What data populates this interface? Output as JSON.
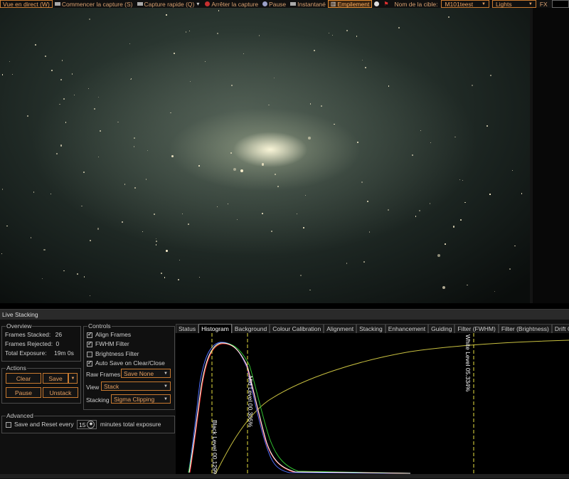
{
  "toolbar": {
    "live_view": "Vue en direct (W)",
    "start_capture": "Commencer la capture (S)",
    "quick_capture": "Capture rapide (Q)",
    "stop_capture": "Arrêter la capture",
    "pause": "Pause",
    "snapshot": "Instantané",
    "stacking": "Empilement",
    "target_label": "Nom de la cible:",
    "target_value": "M101teest",
    "frame_type": "Lights",
    "fx_label": "FX"
  },
  "panel": {
    "title": "Live Stacking",
    "overview": {
      "legend": "Overview",
      "frames_stacked_label": "Frames Stacked:",
      "frames_stacked": "26",
      "frames_rejected_label": "Frames Rejected:",
      "frames_rejected": "0",
      "total_exposure_label": "Total Exposure:",
      "total_exposure": "19m 0s"
    },
    "actions": {
      "legend": "Actions",
      "clear": "Clear",
      "save": "Save",
      "pause": "Pause",
      "unstack": "Unstack"
    },
    "controls": {
      "legend": "Controls",
      "align_frames": "Align Frames",
      "align_frames_checked": true,
      "fwhm_filter": "FWHM Filter",
      "fwhm_filter_checked": true,
      "brightness_filter": "Brightness Filter",
      "brightness_filter_checked": false,
      "auto_save": "Auto Save on Clear/Close",
      "auto_save_checked": true,
      "raw_frames_label": "Raw Frames",
      "raw_frames_value": "Save None",
      "view_label": "View",
      "view_value": "Stack",
      "stacking_label": "Stacking",
      "stacking_value": "Sigma Clipping"
    },
    "advanced": {
      "legend": "Advanced",
      "save_reset_label": "Save and Reset every",
      "save_reset_value": "15",
      "minutes_label": "minutes total exposure",
      "save_reset_checked": false
    }
  },
  "tabs": [
    "Status",
    "Histogram",
    "Background",
    "Colour Calibration",
    "Alignment",
    "Stacking",
    "Enhancement",
    "Guiding",
    "Filter (FWHM)",
    "Filter (Brightness)",
    "Drift G"
  ],
  "active_tab": "Histogram",
  "histogram": {
    "black_level_label": "Black Level 00.129%",
    "mid_level_label": "Mid Level 00.305%",
    "white_level_label": "White Level 05.334%",
    "colors": {
      "red": "#ff3030",
      "green": "#30c030",
      "blue": "#5070ff",
      "white": "#ffffff",
      "curve": "#c8c040",
      "markers": "#e8e040"
    }
  },
  "icons": {
    "record": "record-icon",
    "camera": "camera-icon",
    "stop": "stop-icon",
    "pause": "pause-icon",
    "snapshot": "snapshot-icon",
    "stack": "stack-icon"
  }
}
